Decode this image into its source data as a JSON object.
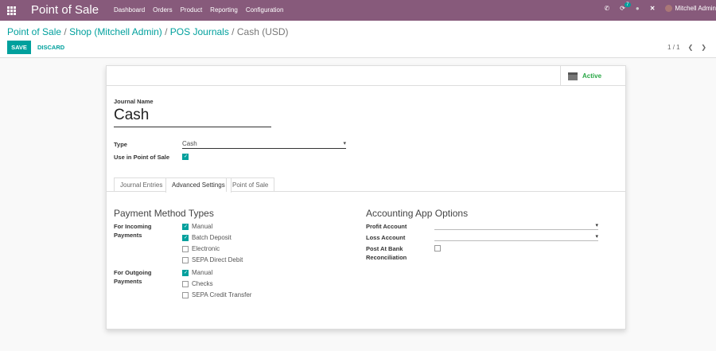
{
  "navbar": {
    "app_title": "Point of Sale",
    "menu": [
      "Dashboard",
      "Orders",
      "Product",
      "Reporting",
      "Configuration"
    ],
    "activity_count": "7",
    "user": "Mitchell Admin"
  },
  "breadcrumb": [
    "Point of Sale",
    "Shop (Mitchell Admin)",
    "POS Journals"
  ],
  "breadcrumb_current": "Cash (USD)",
  "actions": {
    "save": "SAVE",
    "discard": "DISCARD"
  },
  "pager": "1 / 1",
  "status": {
    "active": "Active"
  },
  "form": {
    "journal_name_label": "Journal Name",
    "journal_name": "Cash",
    "type_label": "Type",
    "type_value": "Cash",
    "use_pos_label": "Use in Point of Sale",
    "use_pos": true
  },
  "tabs": [
    "Journal Entries",
    "Advanced Settings",
    "Point of Sale"
  ],
  "active_tab": "Advanced Settings",
  "payment_methods": {
    "title": "Payment Method Types",
    "incoming_label": "For Incoming Payments",
    "incoming": [
      {
        "label": "Manual",
        "checked": true
      },
      {
        "label": "Batch Deposit",
        "checked": true
      },
      {
        "label": "Electronic",
        "checked": false
      },
      {
        "label": "SEPA Direct Debit",
        "checked": false
      }
    ],
    "outgoing_label": "For Outgoing Payments",
    "outgoing": [
      {
        "label": "Manual",
        "checked": true
      },
      {
        "label": "Checks",
        "checked": false
      },
      {
        "label": "SEPA Credit Transfer",
        "checked": false
      }
    ]
  },
  "accounting": {
    "title": "Accounting App Options",
    "profit_label": "Profit Account",
    "profit_value": "",
    "loss_label": "Loss Account",
    "loss_value": "",
    "post_label": "Post At Bank Reconciliation",
    "post": false
  },
  "colors": {
    "brand": "#875a7b",
    "accent": "#00a09d",
    "active": "#28a745"
  }
}
